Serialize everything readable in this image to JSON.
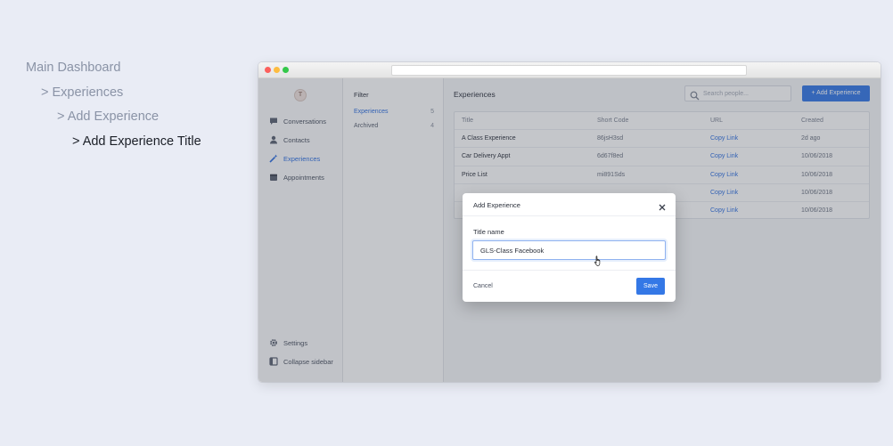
{
  "breadcrumb": [
    {
      "label": "Main Dashboard"
    },
    {
      "label": "> Experiences"
    },
    {
      "label": "> Add Experience"
    },
    {
      "label": "> Add Experience Title"
    }
  ],
  "sidebar": {
    "logo_text": "T",
    "items": [
      {
        "label": "Conversations",
        "icon": "chat-bubble-icon"
      },
      {
        "label": "Contacts",
        "icon": "person-icon"
      },
      {
        "label": "Experiences",
        "icon": "magic-wand-icon",
        "selected": true
      },
      {
        "label": "Appointments",
        "icon": "calendar-icon"
      }
    ],
    "bottom": [
      {
        "label": "Settings",
        "icon": "gear-icon"
      },
      {
        "label": "Collapse sidebar",
        "icon": "collapse-icon"
      }
    ]
  },
  "filter": {
    "title": "Filter",
    "items": [
      {
        "label": "Experiences",
        "count": "5",
        "selected": true
      },
      {
        "label": "Archived",
        "count": "4"
      }
    ]
  },
  "main": {
    "title": "Experiences",
    "search_placeholder": "Search people...",
    "add_button": "+ Add Experience",
    "columns": [
      "Title",
      "Short Code",
      "URL",
      "Created"
    ],
    "rows": [
      {
        "title": "A Class Experience",
        "code": "86jsH3sd",
        "url": "Copy Link",
        "created": "2d ago"
      },
      {
        "title": "Car Delivery Appt",
        "code": "6d67f8ed",
        "url": "Copy Link",
        "created": "10/06/2018"
      },
      {
        "title": "Price List",
        "code": "mi891Sds",
        "url": "Copy Link",
        "created": "10/06/2018"
      },
      {
        "title": "",
        "code": "",
        "url": "Copy Link",
        "created": "10/06/2018"
      },
      {
        "title": "",
        "code": "",
        "url": "Copy Link",
        "created": "10/06/2018"
      }
    ]
  },
  "modal": {
    "title": "Add Experience",
    "field_label": "Title name",
    "field_value": "GLS-Class Facebook",
    "cancel": "Cancel",
    "save": "Save"
  },
  "colors": {
    "accent": "#3478e6",
    "link": "#2e6fe0",
    "page_bg": "#e9ecf5"
  }
}
